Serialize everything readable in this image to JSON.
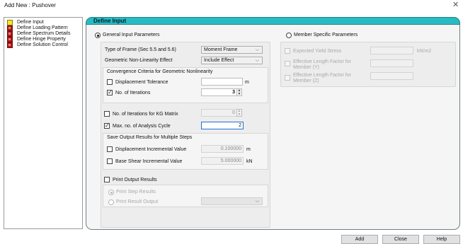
{
  "window": {
    "title": "Add New : Pushover"
  },
  "tree": {
    "items": [
      {
        "label": "Define Input",
        "color": "#f7e631"
      },
      {
        "label": "Define Loading Pattern",
        "color": "#b01818"
      },
      {
        "label": "Define Spectrum Details",
        "color": "#b01818"
      },
      {
        "label": "Define Hinge Property",
        "color": "#b01818"
      },
      {
        "label": "Define Solution Control",
        "color": "#b01818"
      }
    ]
  },
  "panel": {
    "title": "Define Input",
    "header_color": "#27bcc3",
    "general": {
      "radio_label": "General Input Parameters",
      "frame_type": {
        "label": "Type of Frame (Sec 5.5 and 5.6)",
        "value": "Moment Frame"
      },
      "nonlinear": {
        "label": "Geometric Non-Linearity Effect",
        "value": "Include Effect"
      },
      "convergence": {
        "title": "Convergence Criteria for Geometric Nonlinearity",
        "displacement_tolerance": {
          "label": "Displacement Tolerance",
          "value": "",
          "unit": "m",
          "checked": false
        },
        "iterations": {
          "label": "No. of Iterations",
          "value": "3",
          "checked": true
        }
      },
      "kg_iterations": {
        "label": "No. of Iterations for KG Matrix",
        "value": "0",
        "checked": false
      },
      "max_cycle": {
        "label": "Max. no. of Analysis Cycle",
        "value": "2",
        "checked": true
      },
      "save_output": {
        "title": "Save Output Results for Multiple Steps",
        "displacement": {
          "label": "Displacement Incremental Value",
          "value": "0.100000",
          "unit": "m"
        },
        "base_shear": {
          "label": "Base Shear Incremental Value",
          "value": "5.000000",
          "unit": "kN"
        }
      },
      "print_output": {
        "label": "Print Output Results",
        "step_results": "Print Step Results",
        "result_output": "Print Result Output"
      }
    },
    "member": {
      "radio_label": "Member Specific Parameters",
      "yield_stress": {
        "label": "Expected Yield Stress",
        "unit": "kN/m2"
      },
      "elf_y": {
        "label_1": "Effective Length Factor for",
        "label_2": "Member (Y)"
      },
      "elf_z": {
        "label_1": "Effective Length Factor for",
        "label_2": "Member (Z)"
      }
    }
  },
  "buttons": {
    "add": "Add",
    "close": "Close",
    "help": "Help"
  }
}
